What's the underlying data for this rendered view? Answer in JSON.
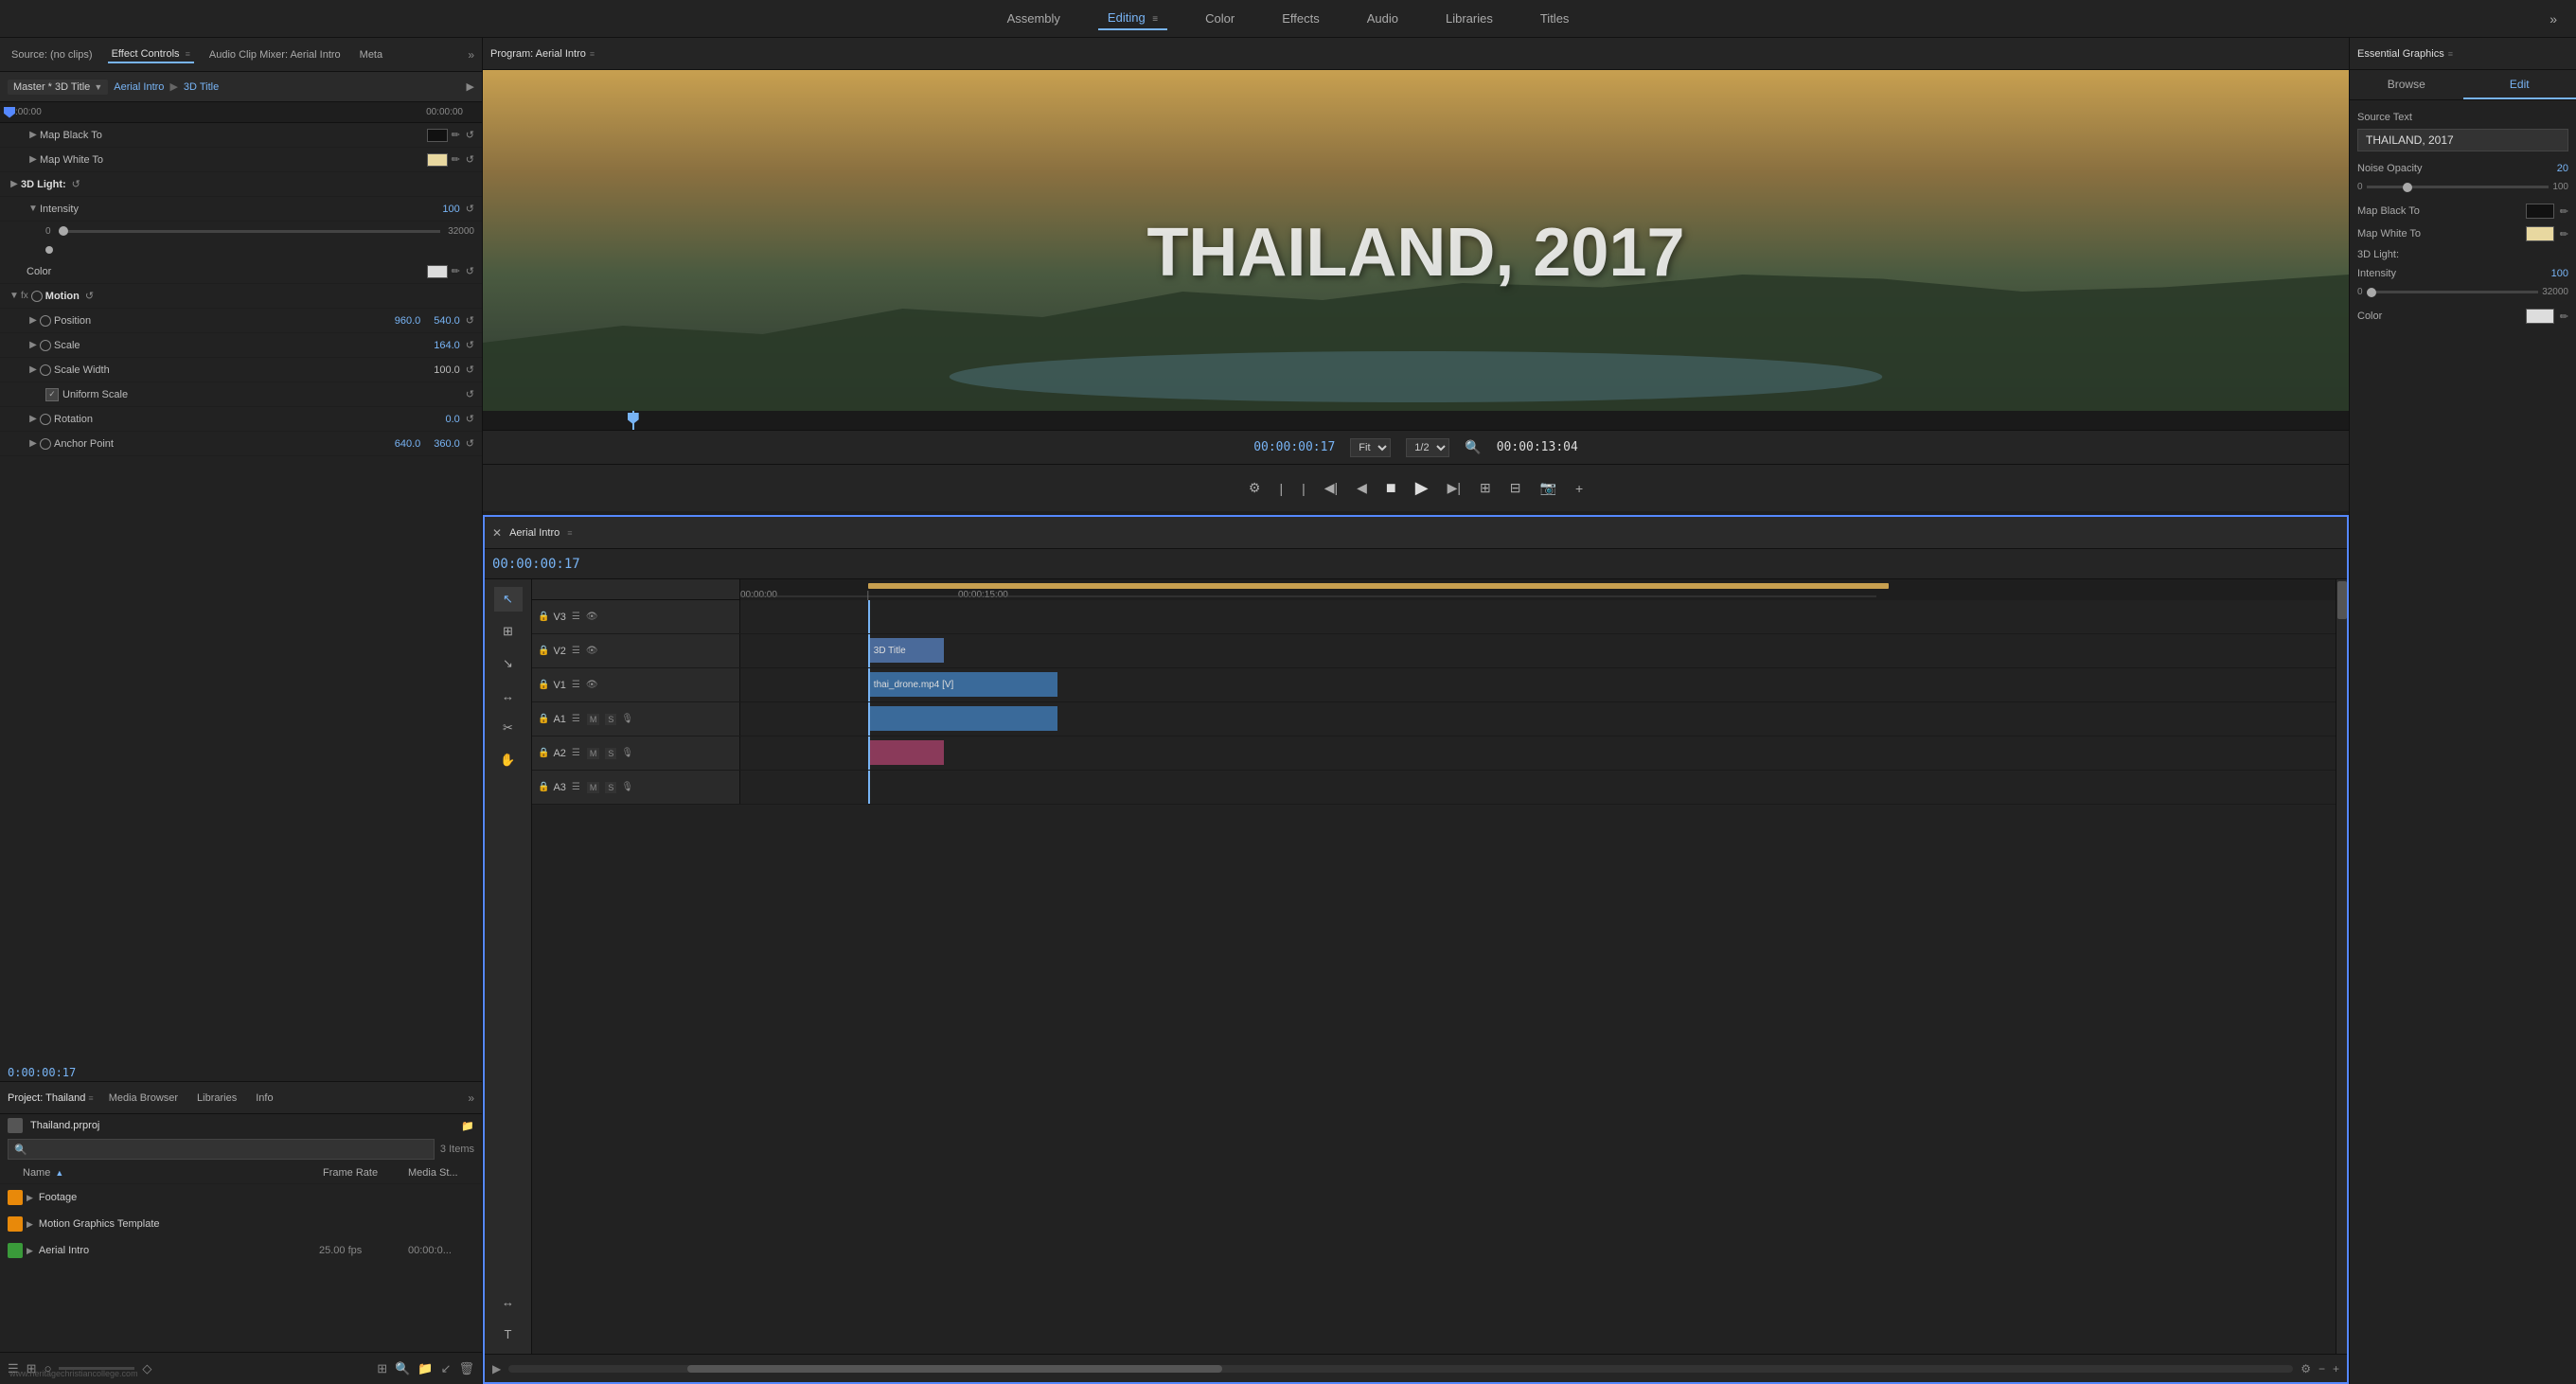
{
  "topNav": {
    "items": [
      {
        "label": "Assembly",
        "active": false
      },
      {
        "label": "Editing",
        "active": true
      },
      {
        "label": "Color",
        "active": false
      },
      {
        "label": "Effects",
        "active": false
      },
      {
        "label": "Audio",
        "active": false
      },
      {
        "label": "Libraries",
        "active": false
      },
      {
        "label": "Titles",
        "active": false
      }
    ],
    "more_label": "»"
  },
  "leftPanel": {
    "tabs": [
      {
        "label": "Source: (no clips)",
        "active": false
      },
      {
        "label": "Effect Controls",
        "active": true
      },
      {
        "label": "Audio Clip Mixer: Aerial Intro",
        "active": false
      },
      {
        "label": "Meta",
        "active": false
      }
    ],
    "more_label": "»",
    "master": {
      "select_label": "Master * 3D Title",
      "arrow": "▼",
      "link1": "Aerial Intro",
      "sep": "▶",
      "link2": "3D Title",
      "forward_arrow": "▶"
    },
    "ruler": {
      "time_left": ":00:00",
      "time_right": "00:00:00"
    },
    "timecode": "0:00:00:17",
    "properties": [
      {
        "indent": 1,
        "expand": false,
        "label": "Map Black To",
        "type": "color_swatch",
        "swatch_color": "#111111",
        "has_eyedropper": true
      },
      {
        "indent": 1,
        "expand": false,
        "label": "Map White To",
        "type": "color_swatch",
        "swatch_color": "#e8d8a0",
        "has_eyedropper": true
      },
      {
        "indent": 0,
        "expand": true,
        "label": "3D Light:",
        "type": "expandable"
      },
      {
        "indent": 1,
        "expand": false,
        "label": "Intensity",
        "value": "100",
        "type": "value"
      },
      {
        "indent": 1,
        "slider": true,
        "min": "0",
        "max": "32000"
      },
      {
        "indent": 1,
        "slider_dot": true
      },
      {
        "indent": 1,
        "expand": false,
        "label": "Color",
        "type": "color_swatch",
        "swatch_color": "#dddddd",
        "has_eyedropper": true
      },
      {
        "indent": 0,
        "expand": true,
        "label": "Motion",
        "type": "fx_motion",
        "is_fx": true
      },
      {
        "indent": 1,
        "expand": false,
        "label": "Position",
        "value1": "960.0",
        "value2": "540.0",
        "type": "double_value"
      },
      {
        "indent": 1,
        "expand": true,
        "label": "Scale",
        "value": "164.0",
        "type": "value"
      },
      {
        "indent": 1,
        "expand": true,
        "label": "Scale Width",
        "value": "100.0",
        "type": "value"
      },
      {
        "indent": 1,
        "checkbox": true,
        "label": "Uniform Scale",
        "type": "checkbox"
      },
      {
        "indent": 1,
        "expand": false,
        "label": "Rotation",
        "value": "0.0",
        "type": "value"
      },
      {
        "indent": 1,
        "expand": false,
        "label": "Anchor Point",
        "value1": "640.0",
        "value2": "360.0",
        "type": "double_value"
      }
    ]
  },
  "programMonitor": {
    "title": "Program: Aerial Intro",
    "menu_icon": "≡",
    "screen_text": "THAILAND, 2017",
    "time_current": "00:00:00:17",
    "fit_label": "Fit",
    "quality_label": "1/2",
    "time_total": "00:00:13:04",
    "controls": {
      "buttons": [
        "⚙",
        "|",
        "|",
        "◀|",
        "◀",
        "■",
        "▶",
        "|▶",
        "⊞",
        "⊟",
        "📷",
        "+"
      ]
    }
  },
  "timeline": {
    "close_btn": "✕",
    "title": "Aerial Intro",
    "menu_icon": "≡",
    "timecode": "00:00:00:17",
    "tracks": [
      {
        "id": "V3",
        "name": "V3",
        "type": "video"
      },
      {
        "id": "V2",
        "name": "V2",
        "type": "video",
        "clip": "3D Title"
      },
      {
        "id": "V1",
        "name": "V1",
        "type": "video",
        "clip": "thai_drone.mp4 [V]"
      },
      {
        "id": "A1",
        "name": "A1",
        "type": "audio",
        "clip": ""
      },
      {
        "id": "A2",
        "name": "A2",
        "type": "audio",
        "clip": ""
      },
      {
        "id": "A3",
        "name": "A3",
        "type": "audio"
      }
    ],
    "ruler_times": [
      "00:00:00",
      "00:00:15:00"
    ]
  },
  "projectPanel": {
    "tabs": [
      {
        "label": "Project: Thailand",
        "active": true
      },
      {
        "label": "Media Browser",
        "active": false
      },
      {
        "label": "Libraries",
        "active": false
      },
      {
        "label": "Info",
        "active": false
      }
    ],
    "project_name": "Thailand.prproj",
    "items_count": "3 Items",
    "search_placeholder": "",
    "columns": {
      "name": "Name",
      "frame_rate": "Frame Rate",
      "media_start": "Media St..."
    },
    "items": [
      {
        "type": "folder",
        "name": "Footage",
        "expanded": false
      },
      {
        "type": "folder",
        "name": "Motion Graphics Template",
        "expanded": false
      },
      {
        "type": "sequence",
        "name": "Aerial Intro",
        "fps": "25.00 fps",
        "media": "00:00:0...",
        "expanded": false
      }
    ]
  },
  "essentialGraphics": {
    "title": "Essential Graphics",
    "menu_icon": "≡",
    "tabs": [
      {
        "label": "Browse",
        "active": false
      },
      {
        "label": "Edit",
        "active": true
      }
    ],
    "source_text_label": "Source Text",
    "source_text_value": "THAILAND, 2017",
    "noise_opacity_label": "Noise Opacity",
    "noise_opacity_value": "20",
    "slider_min": "0",
    "slider_max": "100",
    "map_black_label": "Map Black To",
    "map_white_label": "Map White To",
    "light_3d_label": "3D Light:",
    "intensity_label": "Intensity",
    "intensity_value": "100",
    "intensity_slider_min": "0",
    "intensity_slider_max": "32000",
    "color_label": "Color"
  },
  "icons": {
    "reset": "↺",
    "eyedropper": "✏",
    "expand_right": "▶",
    "expand_down": "▼",
    "lock": "🔒",
    "eye": "👁",
    "search": "🔍",
    "list_view": "☰",
    "icon_view": "⊞",
    "folder": "📁",
    "play": "▶",
    "stop": "■",
    "ff": "▶▶",
    "rr": "◀◀",
    "mic": "🎙",
    "plus": "+",
    "minus": "−",
    "camera": "📷"
  }
}
